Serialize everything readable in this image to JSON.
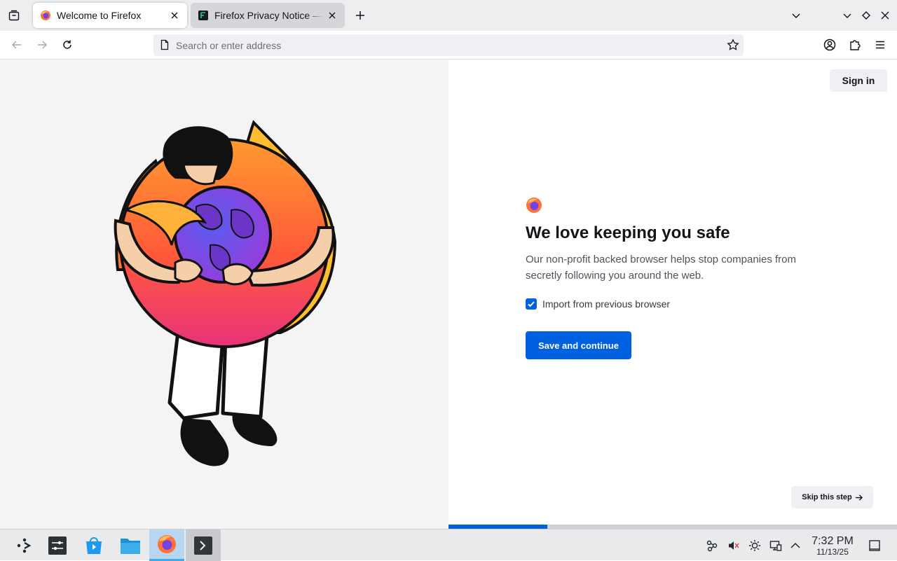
{
  "tabs": [
    {
      "title": "Welcome to Firefox",
      "active": true
    },
    {
      "title": "Firefox Privacy Notice — Mozilla",
      "active": false
    }
  ],
  "urlbar": {
    "placeholder": "Search or enter address",
    "value": ""
  },
  "content": {
    "sign_in": "Sign in",
    "heading": "We love keeping you safe",
    "subtext": "Our non-profit backed browser helps stop companies from secretly following you around the web.",
    "import_label": "Import from previous browser",
    "import_checked": true,
    "save_button": "Save and continue",
    "skip_button": "Skip this step",
    "progress": 0.22
  },
  "taskbar": {
    "time": "7:32 PM",
    "date": "11/13/25"
  },
  "colors": {
    "accent": "#0061e0",
    "page_bg": "#f4f4f4"
  },
  "icons": {
    "tab_manager": "tab-manager-icon",
    "new_tab": "plus-icon",
    "back": "arrow-left-icon",
    "forward": "arrow-right-icon",
    "reload": "reload-icon",
    "bookmark": "star-icon",
    "account": "account-icon",
    "extensions": "puzzle-icon",
    "menu": "hamburger-icon"
  }
}
